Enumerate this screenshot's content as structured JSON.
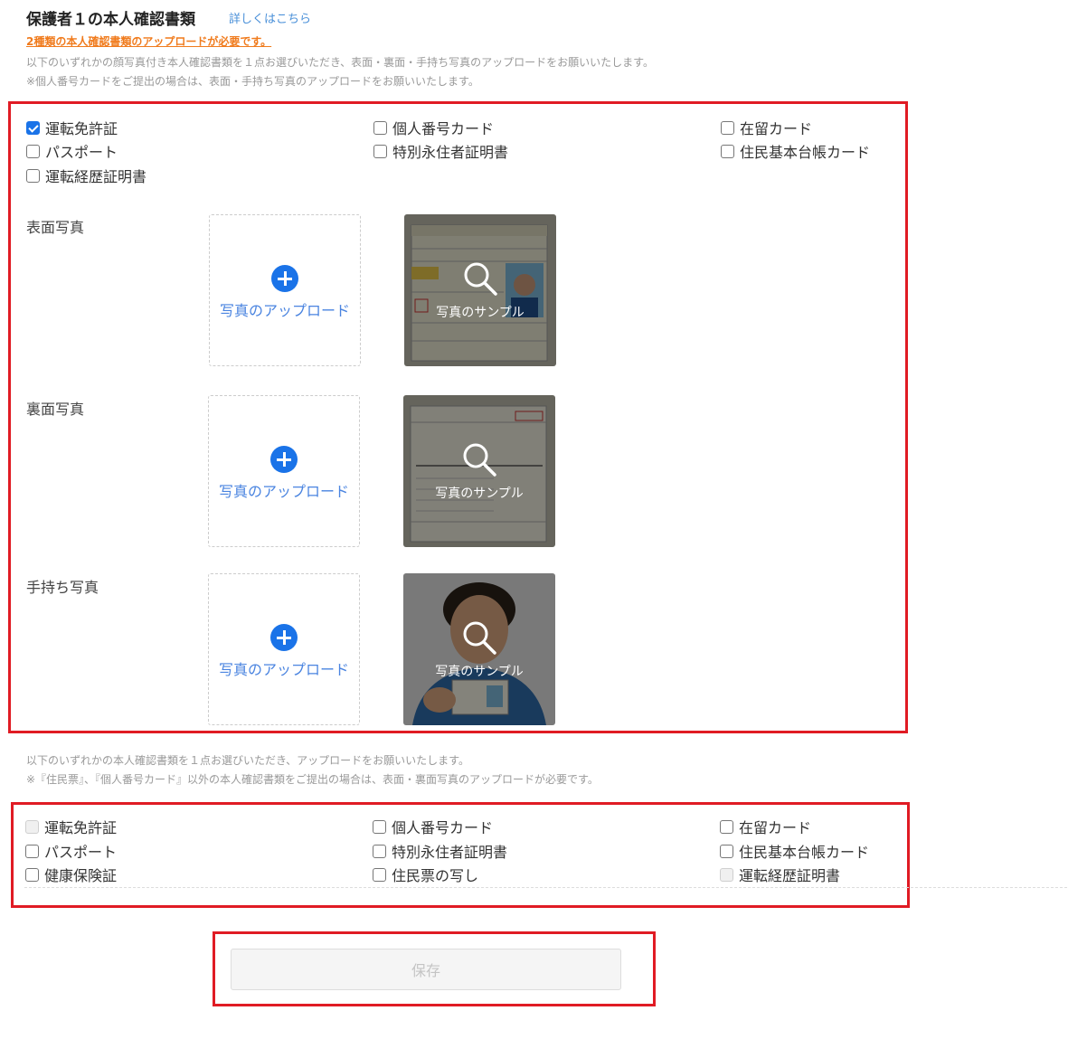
{
  "header": {
    "title": "保護者１の本人確認書類",
    "detail_link": "詳しくはこちら",
    "required_note": "2種類の本人確認書類のアップロードが必要です。",
    "desc_line1": "以下のいずれかの顔写真付き本人確認書類を１点お選びいただき、表面・裏面・手持ち写真のアップロードをお願いいたします。",
    "desc_line2": "※個人番号カードをご提出の場合は、表面・手持ち写真のアップロードをお願いいたします。"
  },
  "photo_id_options": [
    {
      "label": "運転免許証",
      "checked": true
    },
    {
      "label": "個人番号カード",
      "checked": false
    },
    {
      "label": "在留カード",
      "checked": false
    },
    {
      "label": "パスポート",
      "checked": false
    },
    {
      "label": "特別永住者証明書",
      "checked": false
    },
    {
      "label": "住民基本台帳カード",
      "checked": false
    },
    {
      "label": "運転経歴証明書",
      "checked": false
    }
  ],
  "photo_rows": [
    {
      "label": "表面写真",
      "upload_label": "写真のアップロード",
      "sample_label": "写真のサンプル"
    },
    {
      "label": "裏面写真",
      "upload_label": "写真のアップロード",
      "sample_label": "写真のサンプル"
    },
    {
      "label": "手持ち写真",
      "upload_label": "写真のアップロード",
      "sample_label": "写真のサンプル"
    }
  ],
  "second_section": {
    "desc_line1": "以下のいずれかの本人確認書類を１点お選びいただき、アップロードをお願いいたします。",
    "desc_line2": "※『住民票』、『個人番号カード』以外の本人確認書類をご提出の場合は、表面・裏面写真のアップロードが必要です。"
  },
  "second_id_options": [
    {
      "label": "運転免許証",
      "disabled": true
    },
    {
      "label": "個人番号カード",
      "disabled": false
    },
    {
      "label": "在留カード",
      "disabled": false
    },
    {
      "label": "パスポート",
      "disabled": false
    },
    {
      "label": "特別永住者証明書",
      "disabled": false
    },
    {
      "label": "住民基本台帳カード",
      "disabled": false
    },
    {
      "label": "健康保険証",
      "disabled": false
    },
    {
      "label": "住民票の写し",
      "disabled": false
    },
    {
      "label": "運転経歴証明書",
      "disabled": true
    }
  ],
  "save_label": "保存",
  "colors": {
    "accent": "#1a73e8",
    "highlight_border": "#e01b24",
    "note_orange": "#f07b1d"
  }
}
